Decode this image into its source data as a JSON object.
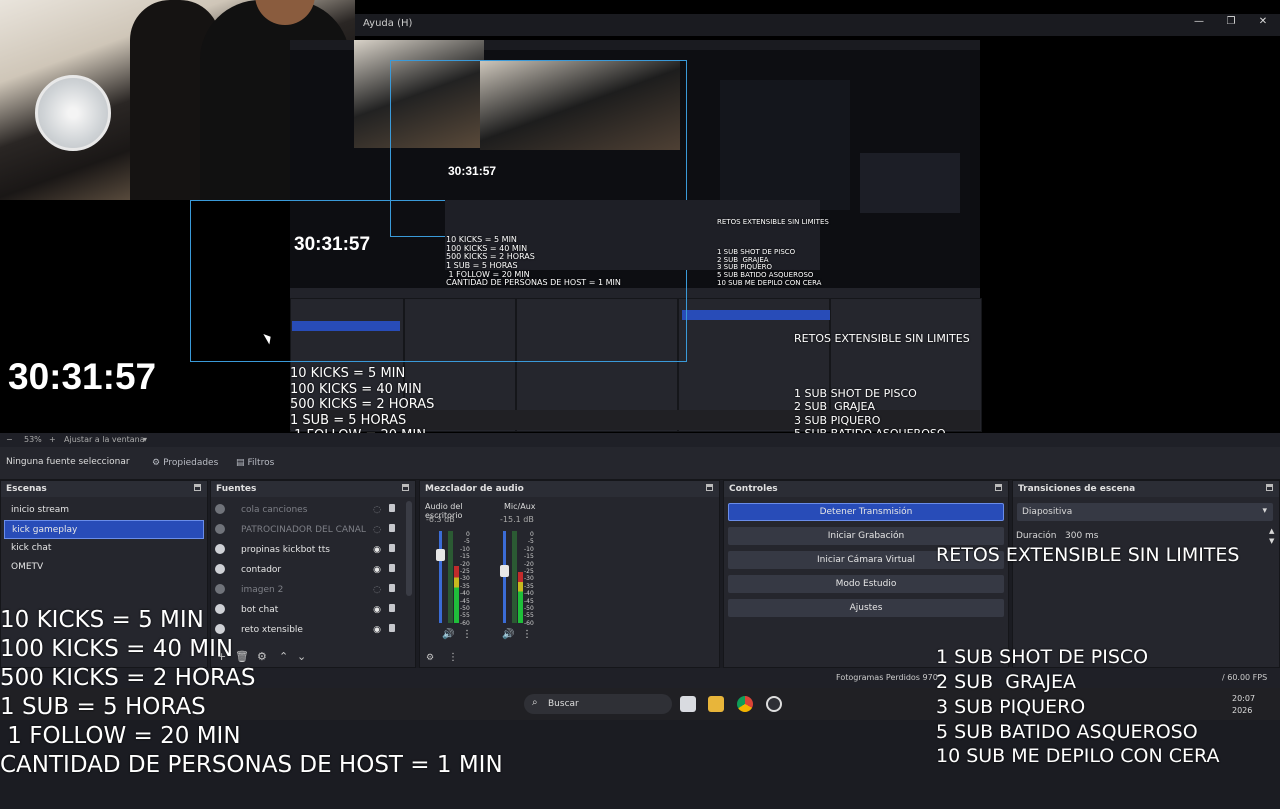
{
  "window": {
    "menu_item": "Ayuda (H)"
  },
  "preview": {
    "timer": "30:31:57",
    "kicks_lines": [
      "10 KICKS = 5 MIN",
      "100 KICKS = 40 MIN",
      "500 KICKS = 2 HORAS",
      "1 SUB = 5 HORAS",
      " 1 FOLLOW = 20 MIN",
      "CANTIDAD DE PERSONAS DE HOST = 1 MIN"
    ],
    "retos_title": "RETOS EXTENSIBLE SIN LIMITES",
    "retos_lines": [
      "1 SUB SHOT DE PISCO",
      "2 SUB  GRAJEA",
      "3 SUB PIQUERO",
      "5 SUB BATIDO ASQUEROSO",
      "10 SUB ME DEPILO CON CERA"
    ]
  },
  "zoom": {
    "percent": "53%",
    "fit_label": "Ajustar a la ventana"
  },
  "context": {
    "no_source": "Ninguna fuente seleccionar",
    "properties": "Propiedades",
    "filters": "Filtros"
  },
  "scenes": {
    "title": "Escenas",
    "items": [
      "inicio stream",
      "kick gameplay",
      "kick chat",
      "OMETV"
    ]
  },
  "sources": {
    "title": "Fuentes",
    "items": [
      "cola canciones",
      "PATROCINADOR DEL CANAL",
      "propinas kickbot tts",
      "contador",
      "imagen 2",
      "bot chat",
      "reto xtensible"
    ]
  },
  "mixer": {
    "title": "Mezclador de audio",
    "channels": [
      {
        "name": "Audio del escritorio",
        "db": "-6.3 dB",
        "level": 0.62
      },
      {
        "name": "Mic/Aux",
        "db": "-15.1 dB",
        "level": 0.55
      }
    ],
    "scale": [
      "0",
      "-5",
      "-10",
      "-15",
      "-20",
      "-25",
      "-30",
      "-35",
      "-40",
      "-45",
      "-50",
      "-55",
      "-60"
    ]
  },
  "controls": {
    "title": "Controles",
    "buttons": [
      "Detener Transmisión",
      "Iniciar Grabación",
      "Iniciar Cámara Virtual",
      "Modo Estudio",
      "Ajustes"
    ]
  },
  "transitions": {
    "title": "Transiciones de escena",
    "selected": "Diapositiva",
    "duration_label": "Duración",
    "duration_value": "300 ms"
  },
  "status": {
    "dropped_frames": "Fotogramas Perdidos 970",
    "fps": "/ 60.00 FPS"
  },
  "taskbar": {
    "search": "Buscar",
    "clock_time": "20:07",
    "clock_date": "2026"
  },
  "colors": {
    "accent": "#284cb8",
    "panel": "#25262d",
    "preview_border": "#3a9ad9"
  }
}
